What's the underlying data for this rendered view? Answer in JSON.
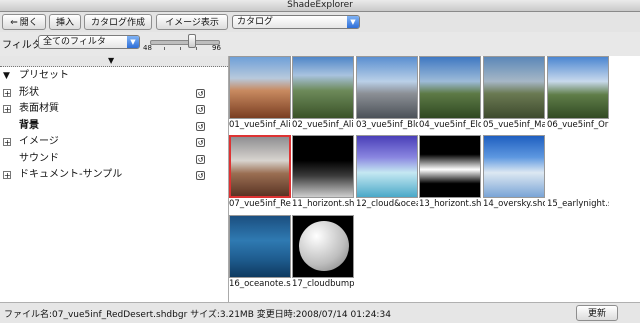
{
  "window": {
    "title": "ShadeExplorer"
  },
  "toolbar": {
    "open_label": "開く",
    "insert_label": "挿入",
    "catalog_create_label": "カタログ作成",
    "image_view_label": "イメージ表示",
    "catalog_select_value": "カタログ"
  },
  "filter": {
    "label": "フィルタ",
    "select_value": "全てのフィルタ",
    "slider_min": "48",
    "slider_max": "96"
  },
  "tree": {
    "items": [
      {
        "label": "プリセット"
      },
      {
        "label": "形状"
      },
      {
        "label": "表面材質"
      },
      {
        "label": "背景"
      },
      {
        "label": "イメージ"
      },
      {
        "label": "サウンド"
      },
      {
        "label": "ドキュメント-サンプル"
      }
    ]
  },
  "thumbnails": [
    {
      "caption": "01_vue5inf_Ali"
    },
    {
      "caption": "02_vue5inf_Ali"
    },
    {
      "caption": "03_vue5inf_Blo"
    },
    {
      "caption": "04_vue5inf_Elo"
    },
    {
      "caption": "05_vue5inf_Ma"
    },
    {
      "caption": "06_vue5inf_Or"
    },
    {
      "caption": "07_vue5inf_Re"
    },
    {
      "caption": "11_horizont.sh"
    },
    {
      "caption": "12_cloud&ocea"
    },
    {
      "caption": "13_horizont.sh"
    },
    {
      "caption": "14_oversky.shc"
    },
    {
      "caption": "15_earlynight.s"
    },
    {
      "caption": "16_oceanote.s"
    },
    {
      "caption": "17_cloudbump"
    }
  ],
  "status": {
    "text": "ファイル名:07_vue5inf_RedDesert.shdbgr サイズ:3.21MB 変更日時:2008/07/14 01:24:34",
    "update_label": "更新"
  }
}
